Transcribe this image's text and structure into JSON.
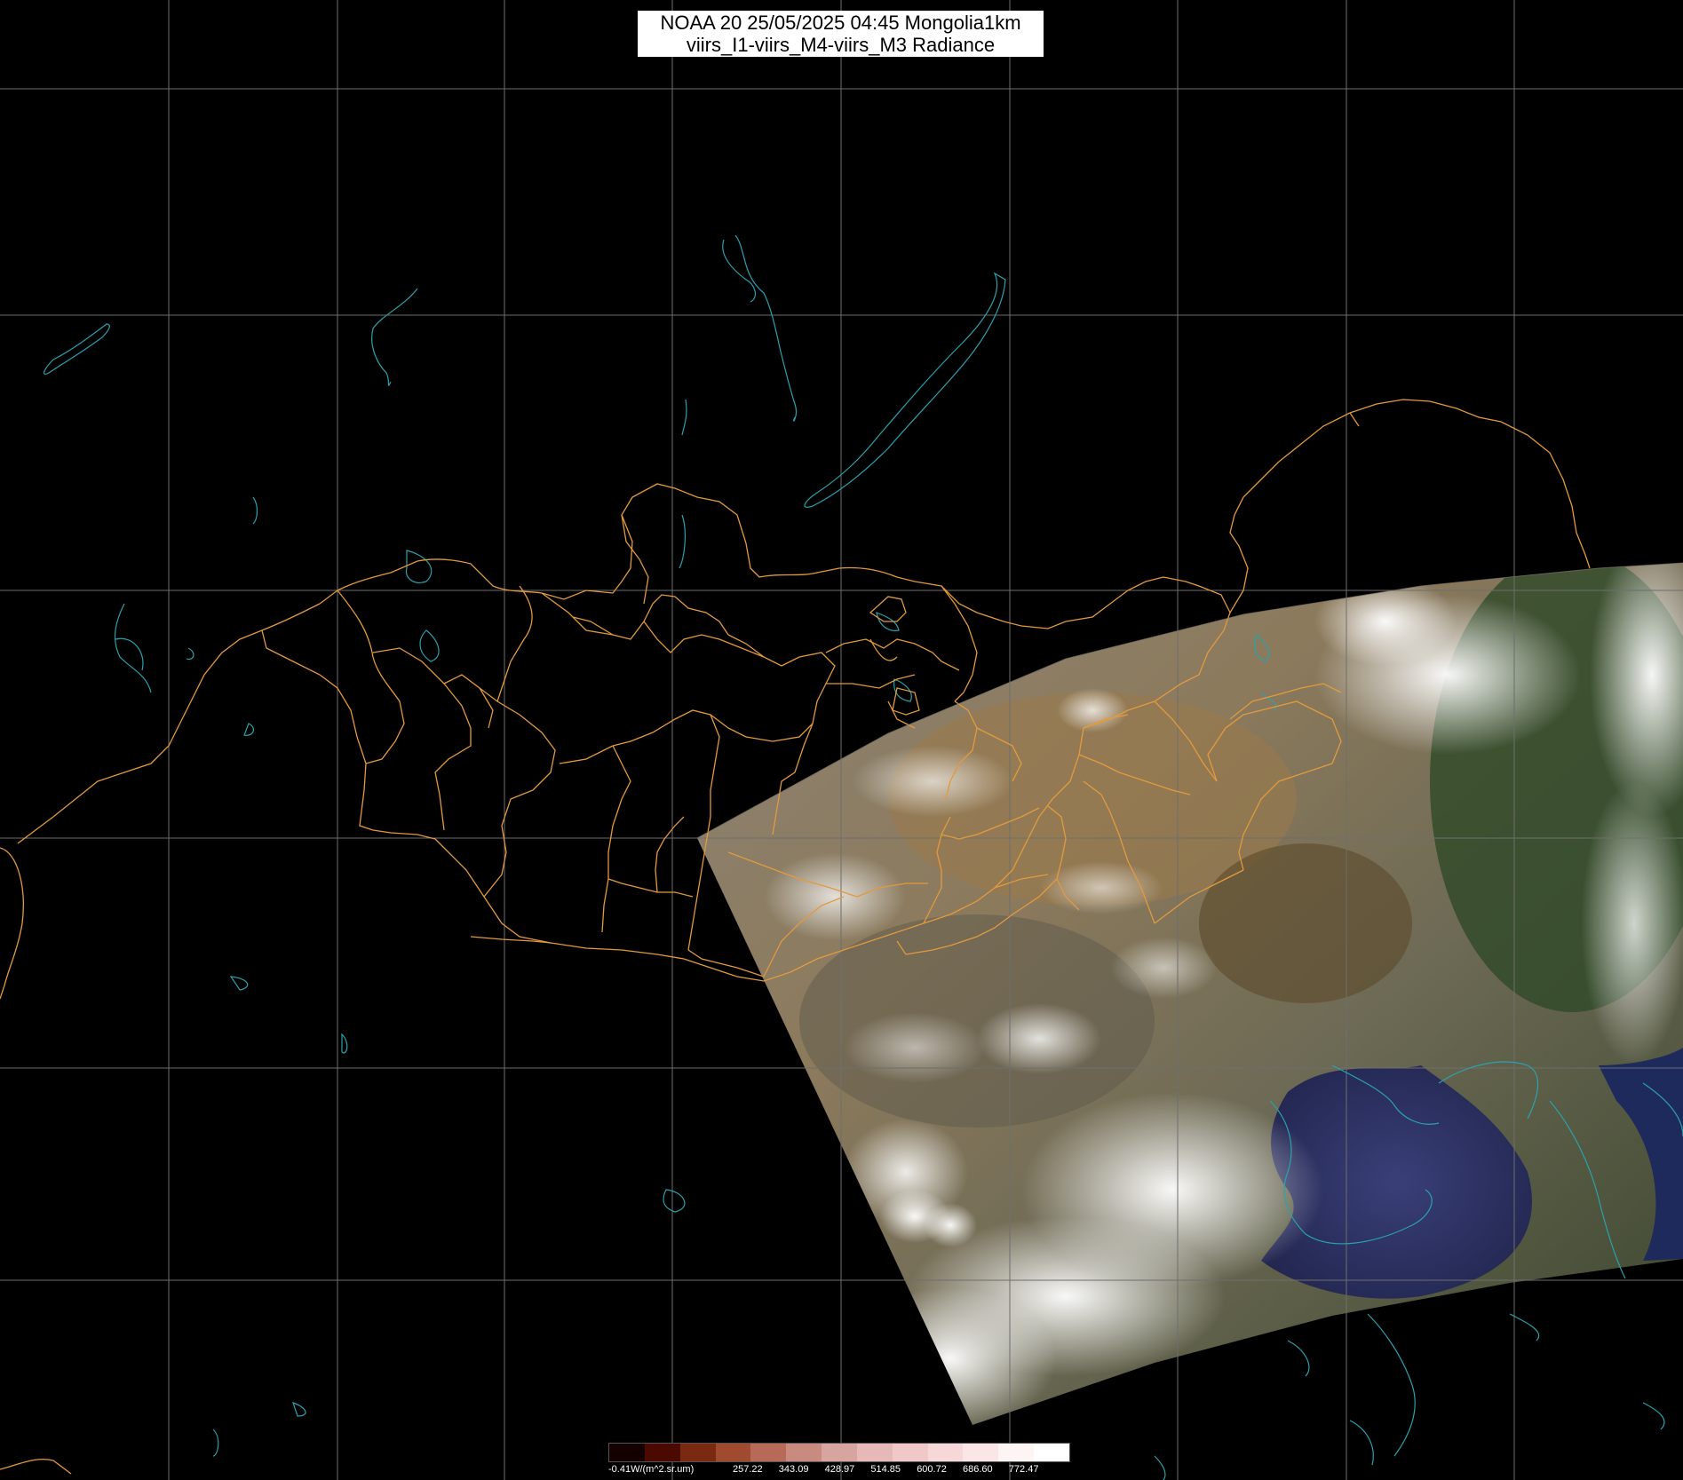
{
  "title": {
    "line1": "NOAA 20 25/05/2025 04:45 Mongolia1km",
    "line2": "viirs_I1-viirs_M4-viirs_M3 Radiance"
  },
  "colors": {
    "background": "#000000",
    "grid": "#6e6e6e",
    "borders": "#e29a3e",
    "coast": "#2aa2ad"
  },
  "legend": {
    "unit_label": "-0.41W/(m^2.sr.um)",
    "ticks": [
      "257.22",
      "343.09",
      "428.97",
      "514.85",
      "600.72",
      "686.60",
      "772.47"
    ],
    "colors": [
      "#140000",
      "#4a0a00",
      "#7a2a10",
      "#a04a30",
      "#b76a58",
      "#c98a80",
      "#d8a4a0",
      "#e6b8b8",
      "#f0c8c8",
      "#f6d8d8",
      "#fae6e6",
      "#fdf4f4",
      "#ffffff"
    ]
  }
}
